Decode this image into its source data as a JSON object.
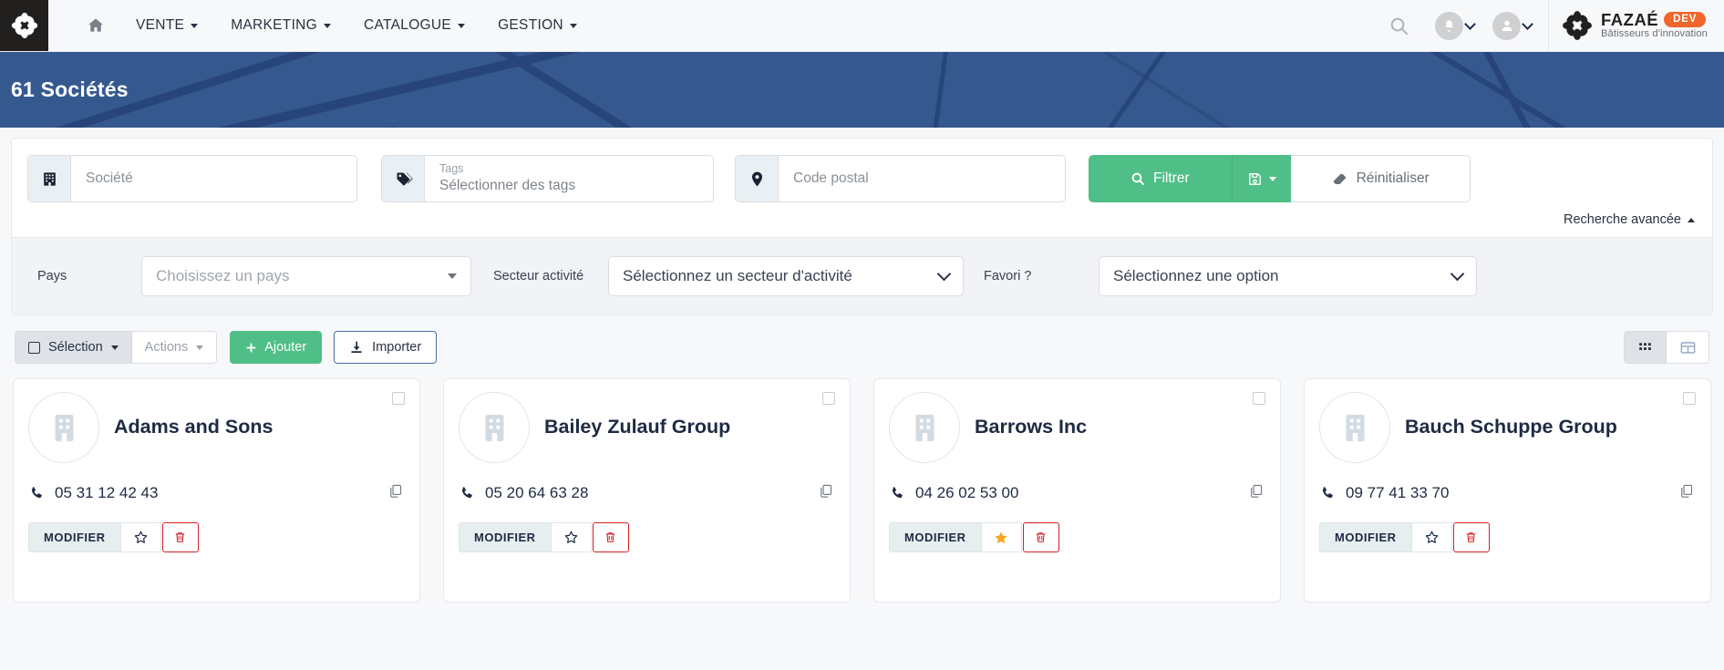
{
  "topnav": {
    "home_icon": "home-icon",
    "menu": [
      {
        "label": "VENTE",
        "has_caret": true
      },
      {
        "label": "MARKETING",
        "has_caret": true
      },
      {
        "label": "CATALOGUE",
        "has_caret": true
      },
      {
        "label": "GESTION",
        "has_caret": true
      }
    ],
    "search_icon": "search-icon",
    "notifications_icon": "bell-icon",
    "user_icon": "user-icon",
    "logo": {
      "mark": "flower-logo-icon",
      "name": "FAZAÉ",
      "badge": "DEV",
      "tagline": "Bâtisseurs d'innovation",
      "badge_color": "#f0662b"
    }
  },
  "banner": {
    "title": "61 Sociétés",
    "bg_color": "#35598f"
  },
  "filters": {
    "societe": {
      "icon": "building-icon",
      "placeholder": "Société",
      "value": ""
    },
    "tags": {
      "icon": "tag-icon",
      "label": "Tags",
      "placeholder": "Sélectionner des tags",
      "value": ""
    },
    "code_postal": {
      "icon": "map-pin-icon",
      "placeholder": "Code postal",
      "value": ""
    },
    "filtrer_label": "Filtrer",
    "filtrer_icon": "search-icon",
    "save_icon": "floppy-disk-icon",
    "reset_label": "Réinitialiser",
    "reset_icon": "eraser-icon",
    "advanced_label": "Recherche avancée",
    "accent_green": "#4fbf87"
  },
  "advanced": {
    "pays": {
      "label": "Pays",
      "value": "Choisissez un pays",
      "muted": true
    },
    "secteur": {
      "label": "Secteur activité",
      "value": "Sélectionnez un secteur d'activité",
      "muted": false
    },
    "favori": {
      "label": "Favori ?",
      "value": "Sélectionnez une option",
      "muted": false
    }
  },
  "toolbar": {
    "selection_label": "Sélection",
    "actions_label": "Actions",
    "ajouter_label": "Ajouter",
    "importer_label": "Importer",
    "view_grid_icon": "grid-view-icon",
    "view_table_icon": "table-view-icon",
    "active_view": "grid"
  },
  "cards": [
    {
      "name": "Adams and Sons",
      "phone": "05 31 12 42 43",
      "favorite": false,
      "checked": false,
      "modifier_label": "MODIFIER"
    },
    {
      "name": "Bailey Zulauf Group",
      "phone": "05 20 64 63 28",
      "favorite": false,
      "checked": false,
      "modifier_label": "MODIFIER"
    },
    {
      "name": "Barrows Inc",
      "phone": "04 26 02 53 00",
      "favorite": true,
      "checked": false,
      "modifier_label": "MODIFIER"
    },
    {
      "name": "Bauch Schuppe Group",
      "phone": "09 77 41 33 70",
      "favorite": false,
      "checked": false,
      "modifier_label": "MODIFIER"
    }
  ],
  "colors": {
    "star_active": "#f5a623",
    "delete_red": "#d61f26",
    "green": "#4fbf87",
    "banner_blue": "#35598f"
  }
}
